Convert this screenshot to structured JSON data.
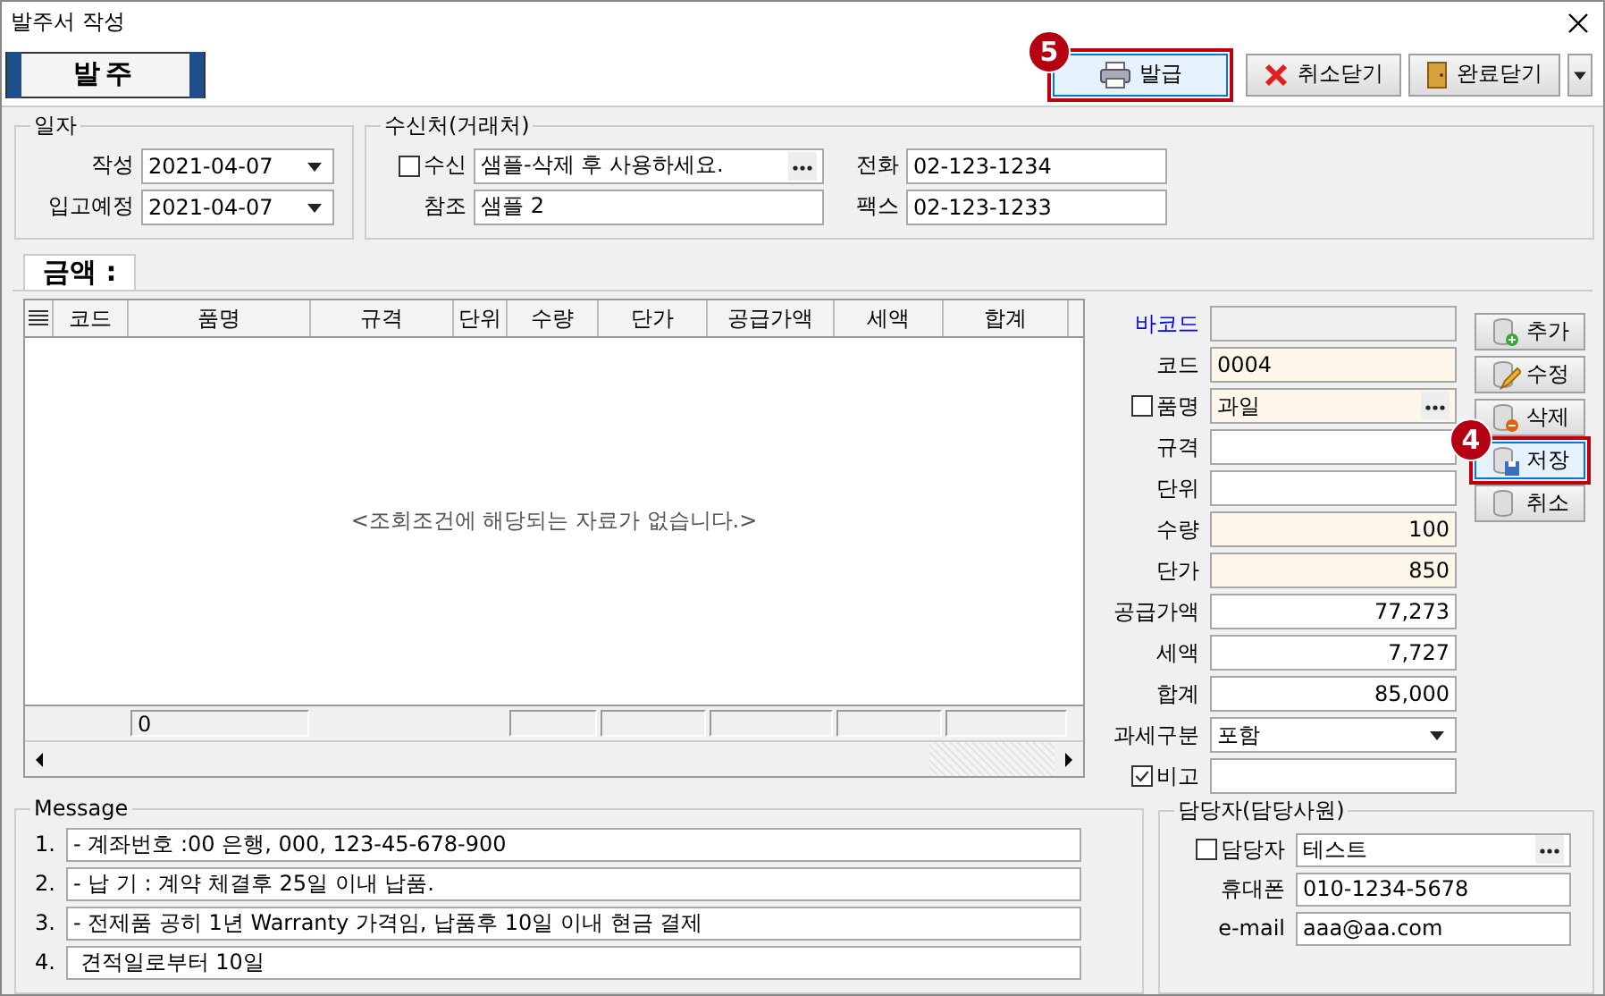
{
  "window": {
    "title": "발주서 작성"
  },
  "header": {
    "title": "발주"
  },
  "toolbar": {
    "buttons": [
      {
        "label": "발급",
        "kind": "print",
        "highlighted": true,
        "badge": "5"
      },
      {
        "label": "취소닫기",
        "kind": "cancel",
        "highlighted": false
      },
      {
        "label": "완료닫기",
        "kind": "done",
        "highlighted": false,
        "dropdown": true
      }
    ]
  },
  "date_group": {
    "title": "일자",
    "fields": [
      {
        "label": "작성",
        "value": "2021-04-07"
      },
      {
        "label": "입고예정",
        "value": "2021-04-07"
      }
    ]
  },
  "recipient": {
    "title": "수신처(거래처)",
    "fields": [
      {
        "label": "수신",
        "kind": "lookup",
        "checked": false,
        "value": "샘플-삭제 후 사용하세요."
      },
      {
        "label": "참조",
        "kind": "text",
        "value": "샘플 2"
      }
    ],
    "contacts": [
      {
        "label": "전화",
        "value": "02-123-1234"
      },
      {
        "label": "팩스",
        "value": "02-123-1233"
      }
    ]
  },
  "tab": {
    "label": "금액 :"
  },
  "grid": {
    "columns": [
      "코드",
      "품명",
      "규격",
      "단위",
      "수량",
      "단가",
      "공급가액",
      "세액",
      "합계"
    ],
    "empty_message": "<조회조건에 해당되는 자료가 없습니다.>",
    "footer_count": "0"
  },
  "detail": {
    "fields": [
      {
        "label": "바코드",
        "kind": "readonly",
        "link": true
      },
      {
        "label": "코드",
        "kind": "text",
        "required": true,
        "value": "0004"
      },
      {
        "label": "품명",
        "kind": "lookup",
        "required": true,
        "checked": false,
        "value": "과일"
      },
      {
        "label": "규격",
        "kind": "text"
      },
      {
        "label": "단위",
        "kind": "text"
      },
      {
        "label": "수량",
        "kind": "number",
        "required": true,
        "value": "100"
      },
      {
        "label": "단가",
        "kind": "number",
        "required": true,
        "value": "850"
      },
      {
        "label": "공급가액",
        "kind": "number",
        "value": "77,273"
      },
      {
        "label": "세액",
        "kind": "number",
        "value": "7,727"
      },
      {
        "label": "합계",
        "kind": "number",
        "value": "85,000"
      },
      {
        "label": "과세구분",
        "kind": "select",
        "value": "포함"
      },
      {
        "label": "비고",
        "kind": "text",
        "checked": true
      }
    ]
  },
  "side_buttons": [
    {
      "label": "추가",
      "kind": "add",
      "highlighted": false
    },
    {
      "label": "수정",
      "kind": "edit",
      "highlighted": false
    },
    {
      "label": "삭제",
      "kind": "delete",
      "highlighted": false
    },
    {
      "label": "저장",
      "kind": "save",
      "highlighted": true,
      "badge": "4"
    },
    {
      "label": "취소",
      "kind": "cancel",
      "highlighted": false
    }
  ],
  "message": {
    "title": "Message",
    "lines": [
      {
        "number": "1.",
        "text": "- 계좌번호 :00 은행, 000, 123-45-678-900"
      },
      {
        "number": "2.",
        "text": "- 납 기 : 계약 체결후 25일 이내 납품."
      },
      {
        "number": "3.",
        "text": "- 전제품 공히 1년 Warranty 가격임, 납품후 10일 이내 현금 결제"
      },
      {
        "number": "4.",
        "text": " 견적일로부터 10일"
      }
    ]
  },
  "manager": {
    "title": "담당자(담당사원)",
    "fields": [
      {
        "label": "담당자",
        "kind": "lookup",
        "checked": false,
        "value": "테스트"
      },
      {
        "label": "휴대폰",
        "kind": "text",
        "value": "010-1234-5678"
      },
      {
        "label": "e-mail",
        "kind": "text",
        "value": "aaa@aa.com"
      }
    ]
  }
}
